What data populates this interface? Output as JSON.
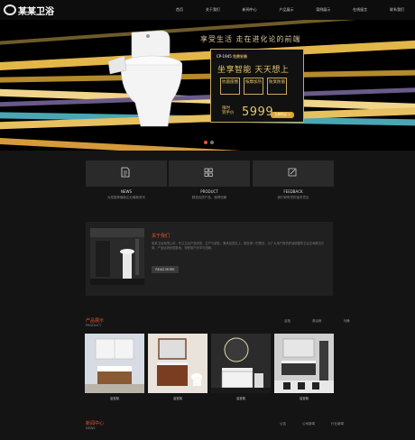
{
  "brand": {
    "name": "某某卫浴"
  },
  "nav": {
    "items": [
      "首页",
      "关于我们",
      "新闻中心",
      "产品展示",
      "案例展示",
      "在线留言",
      "联系我们"
    ]
  },
  "banner": {
    "slogan": "享受生活 走在进化论的前端",
    "tag_prefix": "CP-1945",
    "tag_text": "免费安装",
    "promo_title": "坐享智能 天天想上",
    "features": [
      "抗菌座圈",
      "按摩加热",
      "防臭防菌"
    ],
    "price_label_1": "限时",
    "price_label_2": "到手价",
    "price": "5999",
    "buy_label": "立即购买 >",
    "colors": {
      "gold": "#e6c36f",
      "accent": "#e8532c"
    }
  },
  "tiles": [
    {
      "icon": "document-icon",
      "name": "NEWS",
      "desc": "为您推荐最新企业最新资讯"
    },
    {
      "icon": "grid-icon",
      "name": "PRODUCT",
      "desc": "精选优质产品，值得信赖"
    },
    {
      "icon": "edit-icon",
      "name": "FEEDBACK",
      "desc": "我们倾听您的宝贵意见"
    }
  ],
  "about": {
    "title": "关于我们",
    "text": "某某卫浴有限公司，专注卫浴产品研发、生产与销售，秉承品质至上、服务第一的理念，为广大用户提供舒适便捷的卫浴空间解决方案，产品远销全国各地，深受用户好评与信赖。",
    "more_label": "READ MORE"
  },
  "products": {
    "title": "产品展示",
    "subtitle": "PRODUCT",
    "tabs": [
      "浴柜",
      "淋浴房",
      "马桶"
    ],
    "items": [
      {
        "name": "浴室柜"
      },
      {
        "name": "浴室柜"
      },
      {
        "name": "浴室柜"
      },
      {
        "name": "浴室柜"
      }
    ]
  },
  "news": {
    "title": "新闻中心",
    "subtitle": "NEWS",
    "tabs": [
      "公告",
      "公司新闻",
      "行业新闻"
    ]
  }
}
